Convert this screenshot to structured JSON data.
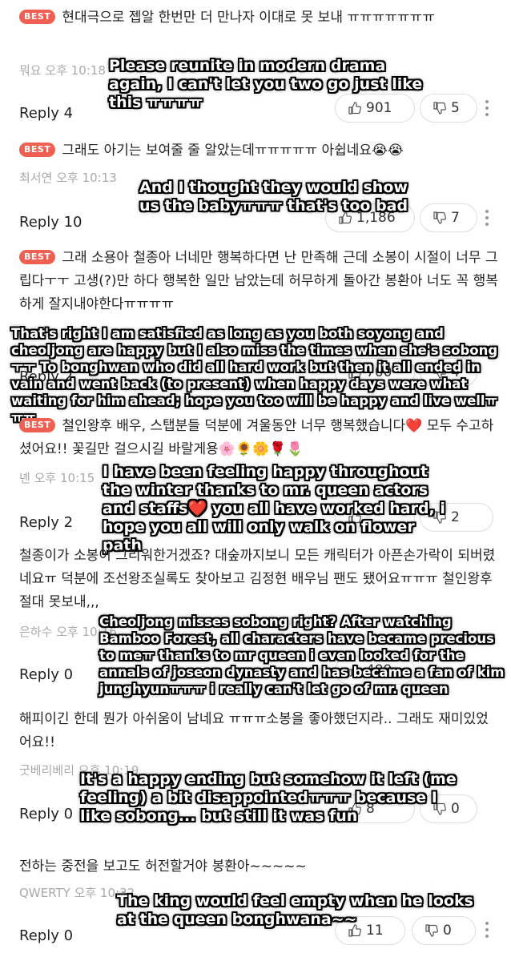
{
  "comments": [
    {
      "badge": "BEST",
      "text": "현대극으로 젭알 한번만 더 만나자 이대로 못 보내 ㅠㅠㅠㅠㅠㅠㅠ",
      "author": "뭐요",
      "time": "오후 10:18",
      "replies": "Reply 4",
      "likes": "901",
      "dislikes": "5",
      "translation": "Please reunite in modern drama again, I can't let you two go just like this ㅠㅠㅠㅠ"
    },
    {
      "badge": "BEST",
      "text": "그래도 아기는 보여줄 줄 알았는데ㅠㅠㅠㅠㅠ 아쉽네요😭😭",
      "author": "최서연",
      "time": "오후 10:13",
      "replies": "Reply 10",
      "likes": "1,186",
      "dislikes": "7",
      "translation": "And I thought they would show us the babyㅠㅠㅠ that's too bad"
    },
    {
      "badge": "BEST",
      "text": "그래 소용아 철종아 너네만 행복하다면 난 만족해 근데 소봉이 시절이 너무 그립다ㅜㅜ 고생(?)만 하다 행복한 일만 남았는데 허무하게 돌아간 봉환아 너도 꼭 행복하게 잘지내야한다ㅠㅠㅠㅠ",
      "author": "",
      "time": "",
      "replies": "Reply 2",
      "likes": "700",
      "dislikes": "4",
      "translation": "That's right I am satisfied as long as you both soyong and cheoljong are happy but I also miss the times when she's sobongㅜㅜ To bonghwan who did all hard work but then it all ended in vain and went back (to present) when happy days were what waiting for him ahead; hope you too will be happy and live wellㅠㅠㅠ"
    },
    {
      "badge": "BEST",
      "text": "철인왕후 배우, 스탭분들 덕분에 겨울동안 너무 행복했습니다❤️ 모두 수고하셨어요!! 꽃길만 걸으시길 바랄게용🌸🌻🌼🌹🌷",
      "author": "녠",
      "time": "오후 10:15",
      "replies": "Reply 2",
      "likes": "",
      "dislikes": "2",
      "translation": "I have been feeling happy throughout the winter thanks to mr. queen actors and staffs❤️ you all have worked hard, i hope you all will only walk on flower path"
    },
    {
      "badge": "",
      "text": "철종이가 소봉이 그리워한거겠죠? 대숲까지보니 모든 캐릭터가 아픈손가락이 되버렸네요ㅠ 덕분에 조선왕조실록도 찾아보고 김정현 배우님 팬도 됐어요ㅠㅠㅠ 철인왕후 절대 못보내,,,",
      "author": "은하수",
      "time": "오후 10:16",
      "replies": "Reply 0",
      "likes": "499",
      "dislikes": "",
      "translation": "Cheoljong misses sobong right? After watching Bamboo Forest, all characters have became precious to meㅠ thanks to mr queen i even looked for the annals of joseon dynasty and has became a fan of kim junghyunㅠㅠㅠ i really can't let go of mr. queen"
    },
    {
      "badge": "",
      "text": "해피이긴 한데 뭔가 아쉬움이 남네요 ㅠㅠㅠ소봉을 좋아했던지라.. 그래도 재미있었어요!!",
      "author": "굿베리베리",
      "time": "오후 10:19",
      "replies": "Reply 0",
      "likes": "8",
      "dislikes": "0",
      "translation": "It's a happy ending but somehow it left (me feeling) a bit disappointedㅠㅠㅠ because I like sobong... but still it was fun"
    },
    {
      "badge": "",
      "text": "전하는 중전을 보고도 허전할거야 봉환아~~~~~",
      "author": "QWERTY",
      "time": "오후 10:32",
      "replies": "Reply 0",
      "likes": "11",
      "dislikes": "0",
      "translation": "The king would feel empty when he looks at the queen bonghwana~~"
    }
  ],
  "icons": {
    "like": "thumbs-up-icon",
    "dislike": "thumbs-down-icon",
    "more": "more-vertical-icon"
  },
  "colors": {
    "best_badge": "#ef5f52",
    "meta_text": "#aaaaaa",
    "translation_text": "#ffffff",
    "translation_outline": "#000000"
  }
}
